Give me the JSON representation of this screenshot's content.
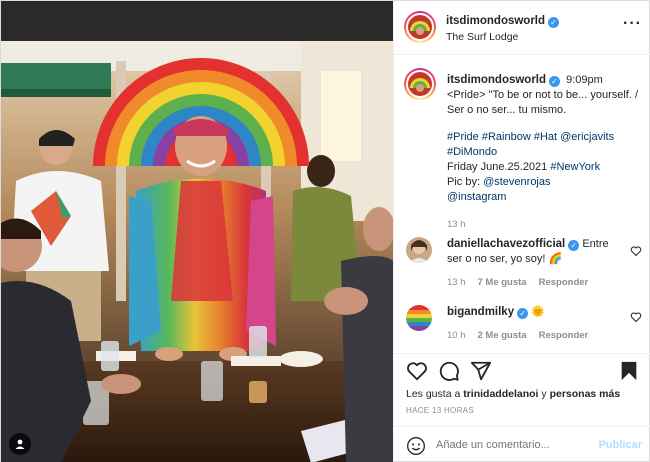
{
  "header": {
    "username": "itsdimondosworld",
    "location": "The Surf Lodge",
    "more_icon": "more-horizontal-icon"
  },
  "caption": {
    "username": "itsdimondosworld",
    "time": "9:09pm",
    "lines": [
      "<Pride> \"To be or not to be... yourself. / Ser o no ser... tu mismo.",
      "#Pride #Rainbow #Hat @ericjavits",
      "#DiMondo",
      "Friday June.25.2021 ",
      "Pic by: @stevenrojas",
      "@instagram"
    ],
    "hashtag_line1": "#Pride #Rainbow #Hat @ericjavits",
    "hashtag_line2": "#DiMondo",
    "date_text": "Friday June.25.2021 ",
    "date_tag": "#NewYork",
    "picby_text": "Pic by: ",
    "picby_tag": "@stevenrojas",
    "instagram_tag": "@instagram",
    "quote": "<Pride> \"To be or not to be... yourself. / Ser o no ser... tu mismo.",
    "age": "13 h"
  },
  "comments": [
    {
      "username": "daniellachavezofficial",
      "text": "Entre ser o no ser, yo soy!",
      "emoji": "🌈",
      "age": "13 h",
      "likes": "7 Me gusta",
      "reply": "Responder"
    },
    {
      "username": "bigandmilky",
      "text": "",
      "emoji": "🌞",
      "age": "10 h",
      "likes": "2 Me gusta",
      "reply": "Responder"
    }
  ],
  "actions": {
    "like_icon": "heart-icon",
    "comment_icon": "comment-icon",
    "share_icon": "share-icon",
    "save_icon": "bookmark-icon"
  },
  "likes": {
    "prefix": "Les gusta a ",
    "user": "trinidaddelanoi",
    "middle": " y ",
    "others": "personas más"
  },
  "timestamp": "HACE 13 HORAS",
  "add_comment": {
    "placeholder": "Añade un comentario...",
    "post_label": "Publicar"
  },
  "colors": {
    "verified": "#3897f0",
    "link": "#00376b",
    "muted": "#8e8e8e",
    "post_disabled": "#b2dffc"
  }
}
